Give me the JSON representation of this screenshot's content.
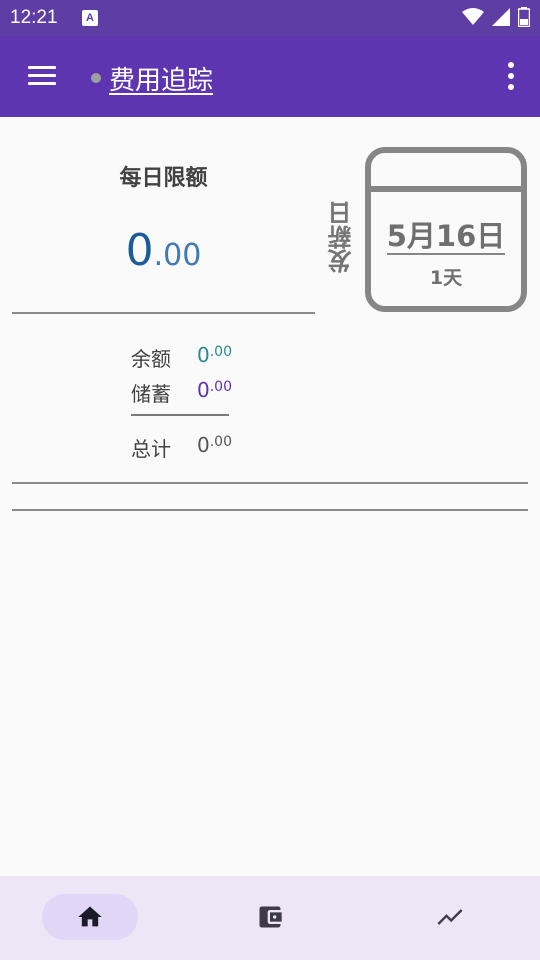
{
  "status_bar": {
    "time": "12:21",
    "app_icon_letter": "A"
  },
  "app_bar": {
    "title": "费用追踪",
    "menu_icon": "hamburger-menu-icon",
    "more_icon": "more-vert-icon"
  },
  "daily": {
    "label": "每日限额",
    "integer": "0",
    "decimal": ".00"
  },
  "payday": {
    "label": "发薪日",
    "date": "5月16日",
    "days_left": "1天"
  },
  "summary": {
    "balance": {
      "label": "余额",
      "integer": "0",
      "decimal": ".00"
    },
    "savings": {
      "label": "储蓄",
      "integer": "0",
      "decimal": ".00"
    },
    "total": {
      "label": "总计",
      "integer": "0",
      "decimal": ".00"
    }
  },
  "bottom_nav": [
    {
      "name": "home",
      "icon": "home-icon",
      "active": true
    },
    {
      "name": "wallet",
      "icon": "wallet-icon",
      "active": false
    },
    {
      "name": "trend",
      "icon": "trending-up-icon",
      "active": false
    }
  ],
  "colors": {
    "app_bar": "#5e35b1",
    "status_bar": "#5e3ea4",
    "amount_blue": "#1a5d99",
    "teal": "#2a8a8a",
    "purple": "#5e35b1",
    "nav_bg": "#ede6f7",
    "nav_active": "#e2d6f6"
  }
}
